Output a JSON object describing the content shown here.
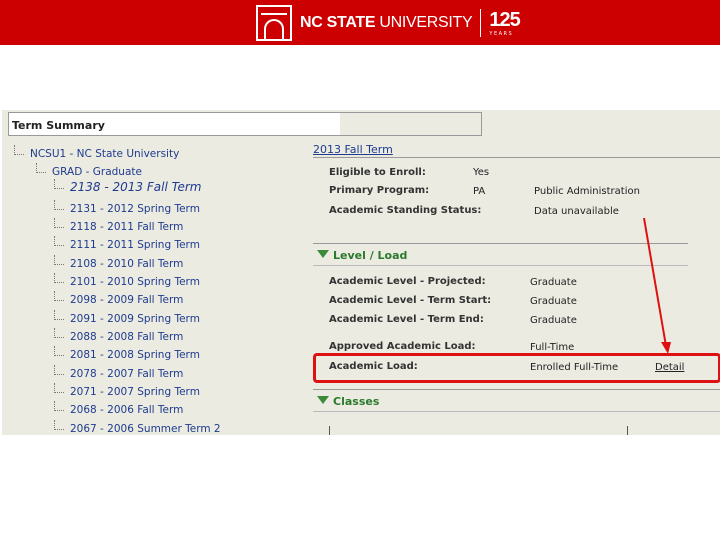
{
  "banner": {
    "brand_bold": "NC STATE",
    "brand_light": " UNIVERSITY",
    "anniversary_number": "125",
    "anniversary_label": "YEARS",
    "color": "#cc0000"
  },
  "term_summary": {
    "header": "Term Summary",
    "tree": [
      {
        "label": "NCSU1 - NC State University"
      },
      {
        "label": "GRAD - Graduate"
      },
      {
        "label": "2138 - 2013 Fall Term",
        "selected": true
      },
      {
        "label": "2131 - 2012 Spring Term"
      },
      {
        "label": "2118 - 2011 Fall Term"
      },
      {
        "label": "2111 - 2011 Spring Term"
      },
      {
        "label": "2108 - 2010 Fall Term"
      },
      {
        "label": "2101 - 2010 Spring Term"
      },
      {
        "label": "2098 - 2009 Fall Term"
      },
      {
        "label": "2091 - 2009 Spring Term"
      },
      {
        "label": "2088 - 2008 Fall Term"
      },
      {
        "label": "2081 - 2008 Spring Term"
      },
      {
        "label": "2078 - 2007 Fall Term"
      },
      {
        "label": "2071 - 2007 Spring Term"
      },
      {
        "label": "2068 - 2006 Fall Term"
      },
      {
        "label": "2067 - 2006 Summer Term 2"
      }
    ]
  },
  "term_detail": {
    "title": "2013 Fall Term",
    "eligible_label": "Eligible to Enroll:",
    "eligible_value": "Yes",
    "program_label": "Primary Program:",
    "program_code": "PA",
    "program_name": "Public Administration",
    "standing_label": "Academic Standing Status:",
    "standing_value": "Data unavailable"
  },
  "level_load": {
    "title": "Level / Load",
    "projected_label": "Academic Level - Projected:",
    "projected_value": "Graduate",
    "start_label": "Academic Level - Term Start:",
    "start_value": "Graduate",
    "end_label": "Academic Level - Term End:",
    "end_value": "Graduate",
    "approved_label": "Approved Academic Load:",
    "approved_value": "Full-Time",
    "load_label": "Academic Load:",
    "load_value": "Enrolled Full-Time",
    "detail_link": "Detail"
  },
  "classes": {
    "title": "Classes"
  },
  "annotation": {
    "highlight_color": "#dd1111"
  }
}
